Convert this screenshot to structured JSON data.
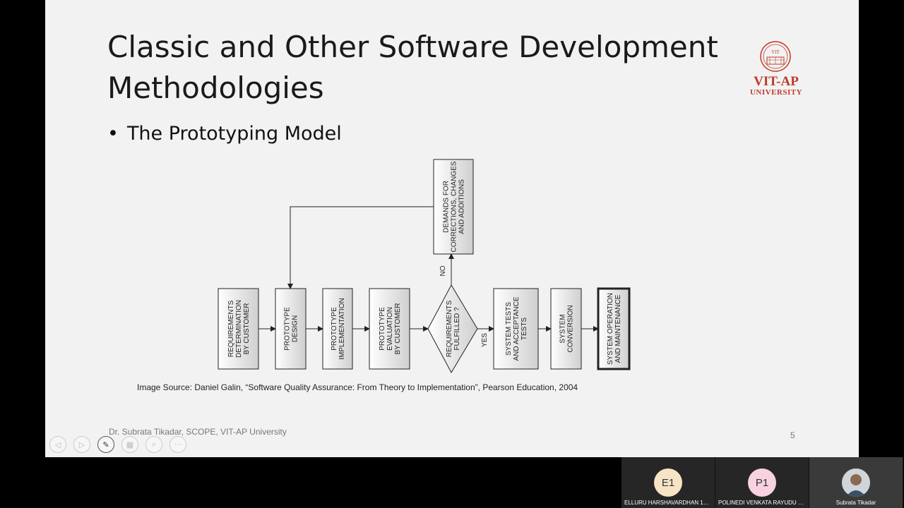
{
  "slide": {
    "title_line1": "Classic and Other Software Development",
    "title_line2": "Methodologies",
    "bullet": "The Prototyping Model",
    "logo": {
      "name": "VIT-AP",
      "sub": "UNIVERSITY",
      "seal_text": "VIT",
      "color": "#c0392b"
    },
    "source": "Image Source: Daniel Galin, “Software Quality Assurance: From Theory to Implementation”, Pearson Education, 2004",
    "footer": "Dr. Subrata Tikadar, SCOPE, VIT-AP University",
    "page_number": "5"
  },
  "diagram": {
    "boxes": [
      [
        "REQUIREMENTS",
        "DETERMINATION",
        "BY CUSTOMER"
      ],
      [
        "PROTOTYPE",
        "DESIGN"
      ],
      [
        "PROTOTYPE",
        "IMPLEMENTATION"
      ],
      [
        "PROTOTYPE",
        "EVALUATION",
        "BY CUSTOMER"
      ],
      [
        "SYSTEM TESTS",
        "AND ACCEPTANCE",
        "TESTS"
      ],
      [
        "SYSTEM",
        "CONVERSION"
      ],
      [
        "SYSTEM OPERATION",
        "AND MAINTENANCE"
      ]
    ],
    "decision": [
      "REQUIREMENTS",
      "FULFILLED ?"
    ],
    "feedback": [
      "DEMANDS FOR",
      "CORRECTIONS, CHANGES",
      "AND ADDITIONS"
    ],
    "no_label": "NO",
    "yes_label": "YES"
  },
  "toolbar": {
    "icons": [
      "previous-icon",
      "next-icon",
      "pen-icon",
      "slides-icon",
      "zoom-icon",
      "more-icon"
    ]
  },
  "participants": [
    {
      "initials": "E1",
      "name": "ELLURU HARSHAVARDHAN 17MIS7...",
      "avatar_color": "#f7e4c4"
    },
    {
      "initials": "P1",
      "name": "POLINEDI VENKATA RAYUDU 17MI...",
      "avatar_color": "#f8d2e0"
    },
    {
      "initials": "",
      "name": "Subrata Tikadar",
      "avatar_color": "#8a6a52"
    }
  ]
}
